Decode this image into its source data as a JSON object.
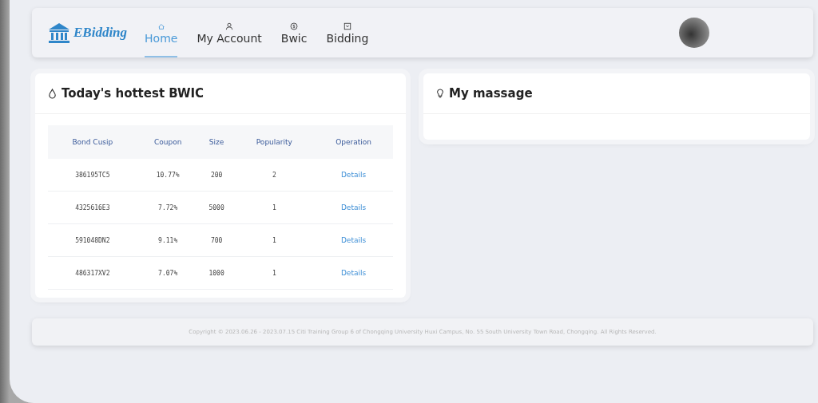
{
  "header": {
    "logo": "EBidding",
    "nav": [
      {
        "label": "Home",
        "kind": "home",
        "selected": true
      },
      {
        "label": "My Account",
        "kind": "user",
        "selected": false
      },
      {
        "label": "Bwic",
        "kind": "coin",
        "selected": false
      },
      {
        "label": "Bidding",
        "kind": "box",
        "selected": false
      }
    ]
  },
  "hottest": {
    "title": "Today's hottest BWIC",
    "columns": [
      "Bond Cusip",
      "Coupon",
      "Size",
      "Popularity",
      "Operation"
    ],
    "rows": [
      {
        "cells": [
          "386195TC5",
          "10.77%",
          "200",
          "2"
        ],
        "action": "Details"
      },
      {
        "cells": [
          "4325616E3",
          "7.72%",
          "5000",
          "1"
        ],
        "action": "Details"
      },
      {
        "cells": [
          "591048DN2",
          "9.11%",
          "700",
          "1"
        ],
        "action": "Details"
      },
      {
        "cells": [
          "486317XV2",
          "7.07%",
          "1000",
          "1"
        ],
        "action": "Details"
      }
    ]
  },
  "messages": {
    "title": "My massage"
  },
  "footer": {
    "text": "Copyright © 2023.06.26 - 2023.07.15 Citi Training Group 6 of Chongqing University Huxi Campus, No. 55 South University Town Road, Chongqing. All Rights Reserved."
  }
}
